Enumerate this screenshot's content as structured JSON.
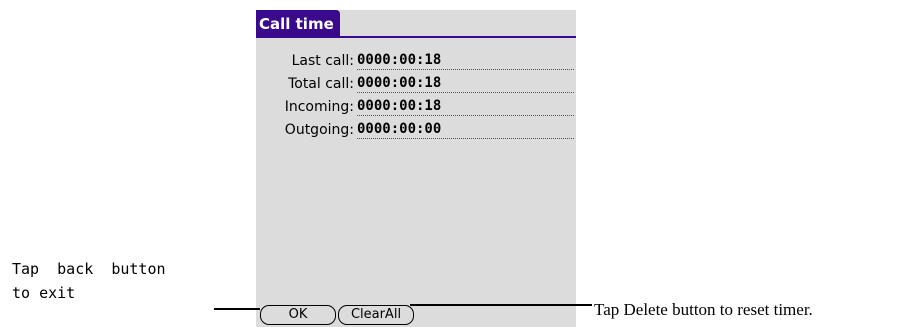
{
  "app": {
    "title": "Call time"
  },
  "stats": [
    {
      "label": "Last call:",
      "value": "0000:00:18"
    },
    {
      "label": "Total call:",
      "value": "0000:00:18"
    },
    {
      "label": "Incoming:",
      "value": "0000:00:18"
    },
    {
      "label": "Outgoing:",
      "value": "0000:00:00"
    }
  ],
  "buttons": {
    "ok": "OK",
    "clear_all": "ClearAll"
  },
  "annotations": {
    "left_line1": "Tap  back  button",
    "left_line2": "to exit",
    "right": "Tap Delete button to reset timer."
  },
  "colors": {
    "title_bg": "#3a0a8c",
    "screen_bg": "#dcdcdc"
  }
}
